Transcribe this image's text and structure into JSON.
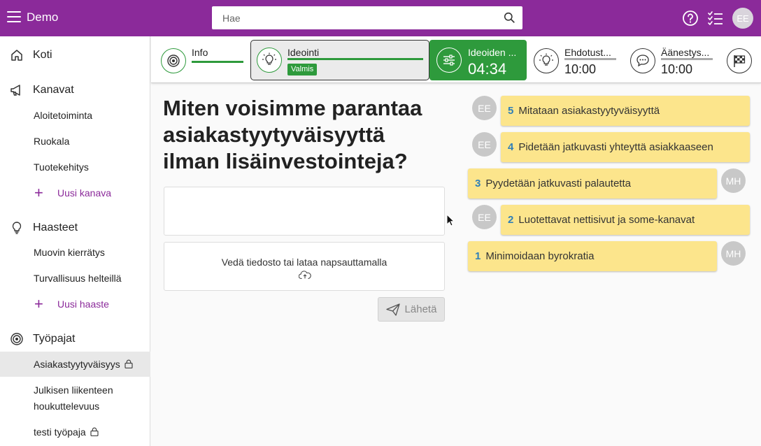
{
  "header": {
    "app_title": "Demo",
    "search_placeholder": "Hae",
    "user_initials": "EE"
  },
  "sidebar": {
    "home_label": "Koti",
    "channels": {
      "label": "Kanavat",
      "items": [
        "Aloitetoiminta",
        "Ruokala",
        "Tuotekehitys"
      ],
      "add_label": "Uusi kanava"
    },
    "challenges": {
      "label": "Haasteet",
      "items": [
        "Muovin kierrätys",
        "Turvallisuus helteillä"
      ],
      "add_label": "Uusi haaste"
    },
    "workshops": {
      "label": "Työpajat",
      "items": [
        {
          "label": "Asiakastyytyväisyys",
          "locked": true
        },
        {
          "label": "Julkisen liikenteen",
          "label2": "houkuttelevuus",
          "locked": false
        },
        {
          "label": "testi työpaja",
          "locked": true
        }
      ]
    }
  },
  "steps": {
    "info": {
      "label": "Info"
    },
    "ideation": {
      "label": "Ideointi",
      "badge": "Valmis"
    },
    "idea_timer": {
      "label": "Ideoiden ...",
      "time": "04:34"
    },
    "proposals": {
      "label": "Ehdotust...",
      "time": "10:00"
    },
    "voting": {
      "label": "Äänestys...",
      "time": "10:00"
    }
  },
  "main": {
    "question_line1": "Miten voisimme parantaa",
    "question_line2": "asiakastyytyväisyyttä",
    "question_line3": "ilman lisäinvestointeja?",
    "upload_text": "Vedä tiedosto tai lataa napsauttamalla",
    "send_label": "Lähetä"
  },
  "ideas": [
    {
      "number": "5",
      "text": "Mitataan asiakastyytyväisyyttä",
      "author": "EE"
    },
    {
      "number": "4",
      "text": "Pidetään jatkuvasti yhteyttä asiakkaaseen",
      "author": "EE"
    },
    {
      "number": "3",
      "text": "Pyydetään jatkuvasti palautetta",
      "author": "MH"
    },
    {
      "number": "2",
      "text": "Luotettavat nettisivut ja some-kanavat",
      "author": "EE"
    },
    {
      "number": "1",
      "text": "Minimoidaan byrokratia",
      "author": "MH"
    }
  ],
  "colors": {
    "brand": "#8b2a9a",
    "active_step": "#2e9a3c",
    "idea_card": "#fce58c",
    "idea_number": "#2f7fb8"
  }
}
